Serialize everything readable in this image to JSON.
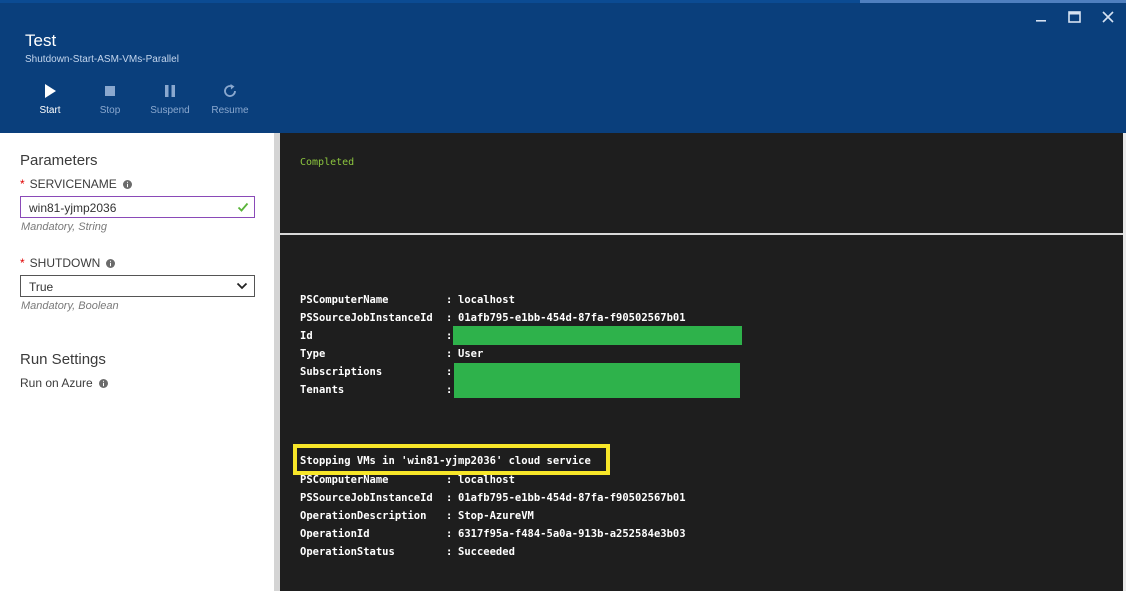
{
  "header": {
    "title": "Test",
    "subtitle": "Shutdown-Start-ASM-VMs-Parallel",
    "toolbar": [
      {
        "label": "Start",
        "icon": "play-icon"
      },
      {
        "label": "Stop",
        "icon": "stop-icon"
      },
      {
        "label": "Suspend",
        "icon": "pause-icon"
      },
      {
        "label": "Resume",
        "icon": "refresh-icon"
      }
    ],
    "window_controls": [
      "minimize-icon",
      "maximize-icon",
      "close-icon"
    ]
  },
  "parameters": {
    "title": "Parameters",
    "servicename": {
      "label": "SERVICENAME",
      "value": "win81-yjmp2036",
      "hint": "Mandatory, String"
    },
    "shutdown": {
      "label": "SHUTDOWN",
      "value": "True",
      "hint": "Mandatory, Boolean"
    }
  },
  "run_settings": {
    "title": "Run Settings",
    "run_on": "Run on Azure"
  },
  "output": {
    "status": "Completed",
    "block1": [
      {
        "key": "PSComputerName",
        "value": "localhost"
      },
      {
        "key": "PSSourceJobInstanceId",
        "value": "01afb795-e1bb-454d-87fa-f90502567b01"
      },
      {
        "key": "Id",
        "value": ""
      },
      {
        "key": "Type",
        "value": "User"
      },
      {
        "key": "Subscriptions",
        "value": ""
      },
      {
        "key": "Tenants",
        "value": ""
      }
    ],
    "stop_message": "Stopping VMs in 'win81-yjmp2036' cloud service",
    "block2": [
      {
        "key": "PSComputerName",
        "value": "localhost"
      },
      {
        "key": "PSSourceJobInstanceId",
        "value": "01afb795-e1bb-454d-87fa-f90502567b01"
      },
      {
        "key": "OperationDescription",
        "value": "Stop-AzureVM"
      },
      {
        "key": "OperationId",
        "value": "6317f95a-f484-5a0a-913b-a252584e3b03"
      },
      {
        "key": "OperationStatus",
        "value": "Succeeded"
      }
    ]
  },
  "colors": {
    "header_bg": "#0a3f7c",
    "console_bg": "#1e1e1e",
    "status_green": "#8dc63f",
    "redaction_green": "#2eb24b",
    "highlight_yellow": "#f7e629"
  }
}
